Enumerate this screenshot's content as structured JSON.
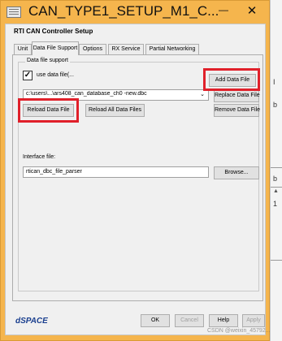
{
  "window": {
    "title": "CAN_TYPE1_SETUP_M1_C...",
    "minimize_symbol": "—",
    "close_symbol": "✕",
    "app_icon": "dialog-window-icon"
  },
  "dialog": {
    "heading": "RTI CAN Controller Setup",
    "tabs": [
      {
        "label": "Unit"
      },
      {
        "label": "Data File Support"
      },
      {
        "label": "Options"
      },
      {
        "label": "RX Service"
      },
      {
        "label": "Partial Networking"
      }
    ],
    "active_tab": "Data File Support"
  },
  "data_file_support": {
    "group_title": "Data file support",
    "use_data_file_label": "use data file(...",
    "use_data_file_checked": true,
    "check_mark": "✓",
    "data_file_path": "c:\\users\\...\\ars408_can_database_ch0 -new.dbc",
    "combo_arrow": "⌄",
    "buttons": {
      "add_data_file": "Add Data File",
      "replace_data_file": "Replace Data File",
      "reload_data_file": "Reload Data File",
      "reload_all_data_files": "Reload All Data Files",
      "remove_data_file": "Remove Data File",
      "browse": "Browse..."
    },
    "interface_file_label": "Interface file:",
    "interface_file_value": "rtican_dbc_file_parser"
  },
  "footer": {
    "logo_text": "dSPACE",
    "ok": "OK",
    "cancel": "Cancel",
    "help": "Help",
    "apply": "Apply"
  },
  "background": {
    "fragment_1": "I",
    "fragment_2": "b",
    "fragment_3": "b",
    "fragment_4": "1",
    "scroll_up": "▲"
  },
  "watermark": "CSDN @weixin_45792..."
}
